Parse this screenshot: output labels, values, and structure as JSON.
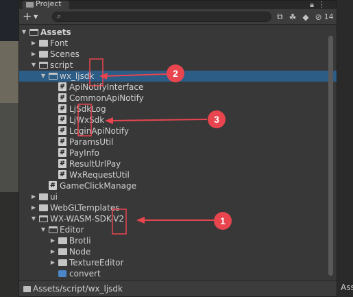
{
  "window": {
    "tab_label": "Project",
    "lock_icon": "lock-icon",
    "menu_icon": "kebab-menu-icon",
    "search_placeholder": "",
    "hidden_count": "14",
    "footer_path": "Assets/script/wx_ljsdk",
    "right_panel_label": "Ass"
  },
  "tree": [
    {
      "label": "Assets",
      "kind": "folder-open",
      "expanded": true,
      "bold": true
    },
    {
      "label": "Font",
      "kind": "folder",
      "expanded": false
    },
    {
      "label": "Scenes",
      "kind": "folder",
      "expanded": false
    },
    {
      "label": "script",
      "kind": "folder-open",
      "expanded": true
    },
    {
      "label": "wx_ljsdk",
      "kind": "folder-open",
      "expanded": true,
      "selected": true
    },
    {
      "label": "ApiNotifyInterface",
      "kind": "cs"
    },
    {
      "label": "CommonApiNotify",
      "kind": "cs"
    },
    {
      "label": "LjSdkLog",
      "kind": "cs"
    },
    {
      "label": "LjWxSdk",
      "kind": "cs"
    },
    {
      "label": "LoginApiNotify",
      "kind": "cs"
    },
    {
      "label": "ParamsUtil",
      "kind": "cs"
    },
    {
      "label": "PayInfo",
      "kind": "cs"
    },
    {
      "label": "ResultUrlPay",
      "kind": "cs"
    },
    {
      "label": "WxRequestUtil",
      "kind": "cs"
    },
    {
      "label": "GameClickManage",
      "kind": "cs"
    },
    {
      "label": "ui",
      "kind": "folder",
      "expanded": false
    },
    {
      "label": "WebGLTemplates",
      "kind": "folder",
      "expanded": false
    },
    {
      "label": "WX-WASM-SDK-V2",
      "kind": "folder-open",
      "expanded": true
    },
    {
      "label": "Editor",
      "kind": "folder-open",
      "expanded": true
    },
    {
      "label": "Brotli",
      "kind": "folder",
      "expanded": false
    },
    {
      "label": "Node",
      "kind": "folder",
      "expanded": false
    },
    {
      "label": "TextureEditor",
      "kind": "folder",
      "expanded": false
    },
    {
      "label": "convert",
      "kind": "asset"
    }
  ],
  "annotations": [
    {
      "number": "1",
      "color": "#e8454f"
    },
    {
      "number": "2",
      "color": "#e8454f"
    },
    {
      "number": "3",
      "color": "#e8454f"
    }
  ]
}
